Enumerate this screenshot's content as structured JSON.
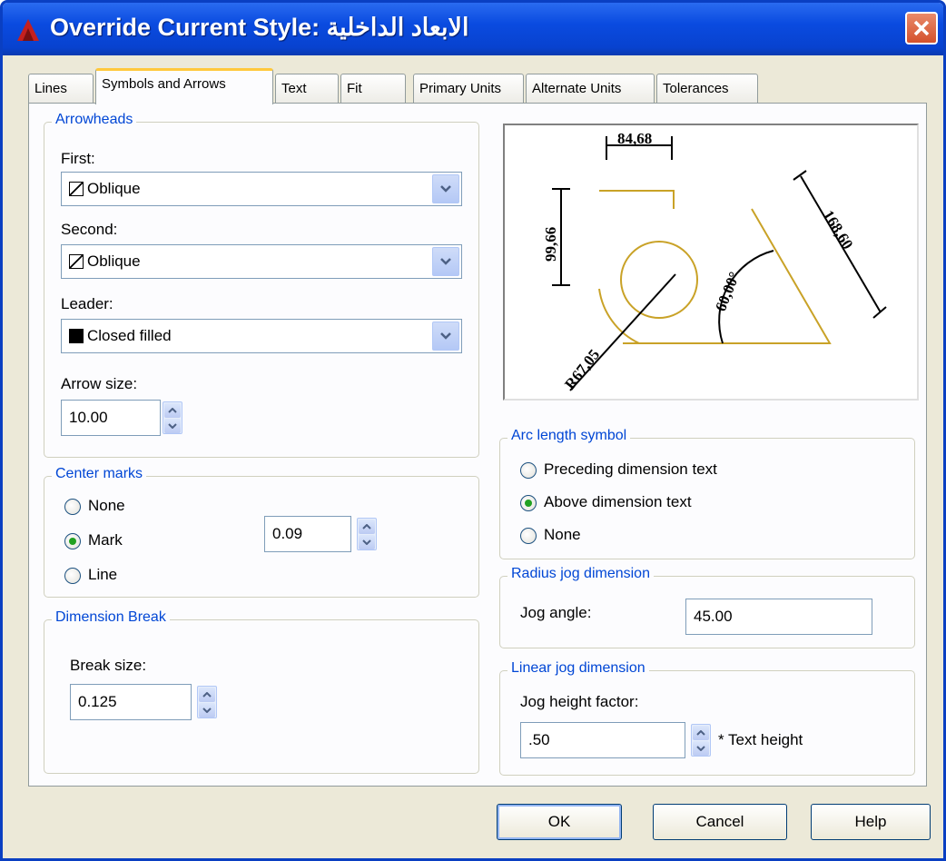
{
  "window": {
    "title": "Override Current Style: الابعاد الداخلية"
  },
  "tabs": [
    {
      "label": "Lines",
      "active": false
    },
    {
      "label": "Symbols and Arrows",
      "active": true
    },
    {
      "label": "Text",
      "active": false
    },
    {
      "label": "Fit",
      "active": false
    },
    {
      "label": "Primary Units",
      "active": false
    },
    {
      "label": "Alternate Units",
      "active": false
    },
    {
      "label": "Tolerances",
      "active": false
    }
  ],
  "arrowheads": {
    "legend": "Arrowheads",
    "first_label": "First:",
    "first_value": "Oblique",
    "second_label": "Second:",
    "second_value": "Oblique",
    "leader_label": "Leader:",
    "leader_value": "Closed filled",
    "arrow_size_label": "Arrow size:",
    "arrow_size_value": "10.00"
  },
  "center_marks": {
    "legend": "Center marks",
    "options": [
      "None",
      "Mark",
      "Line"
    ],
    "selected": "Mark",
    "value": "0.09"
  },
  "dimension_break": {
    "legend": "Dimension Break",
    "break_size_label": "Break size:",
    "break_size_value": "0.125"
  },
  "preview": {
    "dim_top": "84,68",
    "dim_left": "99,66",
    "dim_right": "168,60",
    "dim_angle": "60,00°",
    "dim_radius": "R67,05"
  },
  "arc_length_symbol": {
    "legend": "Arc length symbol",
    "options": [
      "Preceding dimension text",
      "Above dimension text",
      "None"
    ],
    "selected": "Above dimension text"
  },
  "radius_jog": {
    "legend": "Radius jog dimension",
    "jog_angle_label": "Jog angle:",
    "jog_angle_value": "45.00"
  },
  "linear_jog": {
    "legend": "Linear jog dimension",
    "factor_label": "Jog height factor:",
    "factor_value": ".50",
    "suffix": "* Text height"
  },
  "buttons": {
    "ok": "OK",
    "cancel": "Cancel",
    "help": "Help"
  },
  "colors": {
    "accent": "#0046d5",
    "titlebar": "#0a4be0",
    "geometry": "#c9a227"
  }
}
